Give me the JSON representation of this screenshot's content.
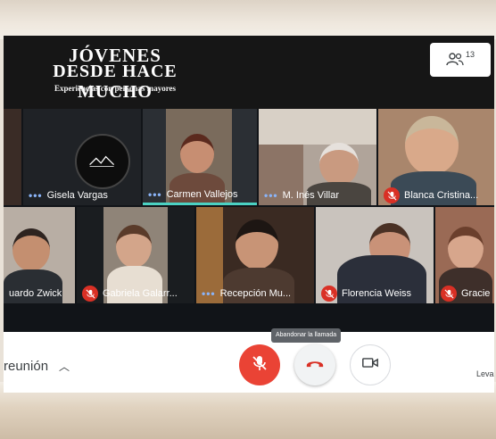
{
  "header": {
    "logo_line1": "JÓVENES",
    "logo_line2": "DESDE HACE MUCHO",
    "tagline": "Experiencias con personas mayores",
    "participants_count": "13"
  },
  "participants": [
    {
      "name": "Gisela Vargas",
      "status": "speaking-dots"
    },
    {
      "name": "Carmen Vallejos",
      "status": "speaking-dots"
    },
    {
      "name": "M. Inés Villar",
      "status": "speaking-dots"
    },
    {
      "name": "Blanca Cristina...",
      "status": "muted"
    },
    {
      "name": "uardo Zwick",
      "status": "none"
    },
    {
      "name": "Gabriela Galarr...",
      "status": "muted"
    },
    {
      "name": "Recepción Mu...",
      "status": "speaking-dots"
    },
    {
      "name": "Florencia Weiss",
      "status": "muted"
    },
    {
      "name": "Gracie",
      "status": "muted"
    }
  ],
  "controls": {
    "meeting_label": "reunión",
    "tooltip": "Abandonar la llamada",
    "leave_label": "Leva"
  },
  "colors": {
    "header_bg": "#161616",
    "grid_bg": "#111418",
    "mic_off": "#d93025",
    "mic_button": "#ea4335",
    "hangup_icon": "#d93025",
    "dots": "#8ab4f8"
  },
  "icons": {
    "participants": "people-icon",
    "chevron": "chevron-up-icon",
    "mic": "mic-off-icon",
    "hangup": "phone-hangup-icon",
    "camera": "videocam-icon"
  }
}
